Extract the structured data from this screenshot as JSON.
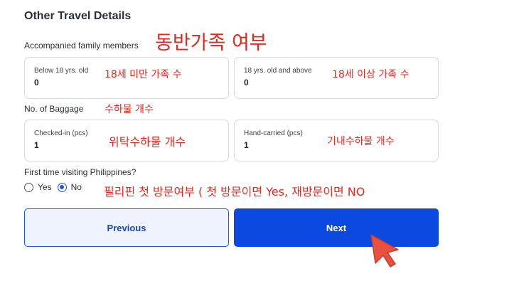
{
  "section_title": "Other Travel Details",
  "family": {
    "label": "Accompanied family members",
    "annotation": "동반가족 여부",
    "below18": {
      "label": "Below 18 yrs. old",
      "value": "0",
      "annotation": "18세 미만 가족 수"
    },
    "above18": {
      "label": "18 yrs. old and above",
      "value": "0",
      "annotation": "18세 이상 가족 수"
    }
  },
  "baggage": {
    "label": "No. of Baggage",
    "annotation": "수하물 개수",
    "checked_in": {
      "label": "Checked-in (pcs)",
      "value": "1",
      "annotation": "위탁수하물 개수"
    },
    "hand_carried": {
      "label": "Hand-carried (pcs)",
      "value": "1",
      "annotation": "기내수하물 개수"
    }
  },
  "first_visit": {
    "question": "First time visiting Philippines?",
    "options": [
      "Yes",
      "No"
    ],
    "selected": "No",
    "annotation": "필리핀 첫 방문여부 ( 첫 방문이면 Yes, 재방문이면 NO"
  },
  "buttons": {
    "previous": "Previous",
    "next": "Next"
  },
  "colors": {
    "primary": "#0b49e0",
    "annotation": "#e8271b",
    "cursor": "#e8503f"
  }
}
